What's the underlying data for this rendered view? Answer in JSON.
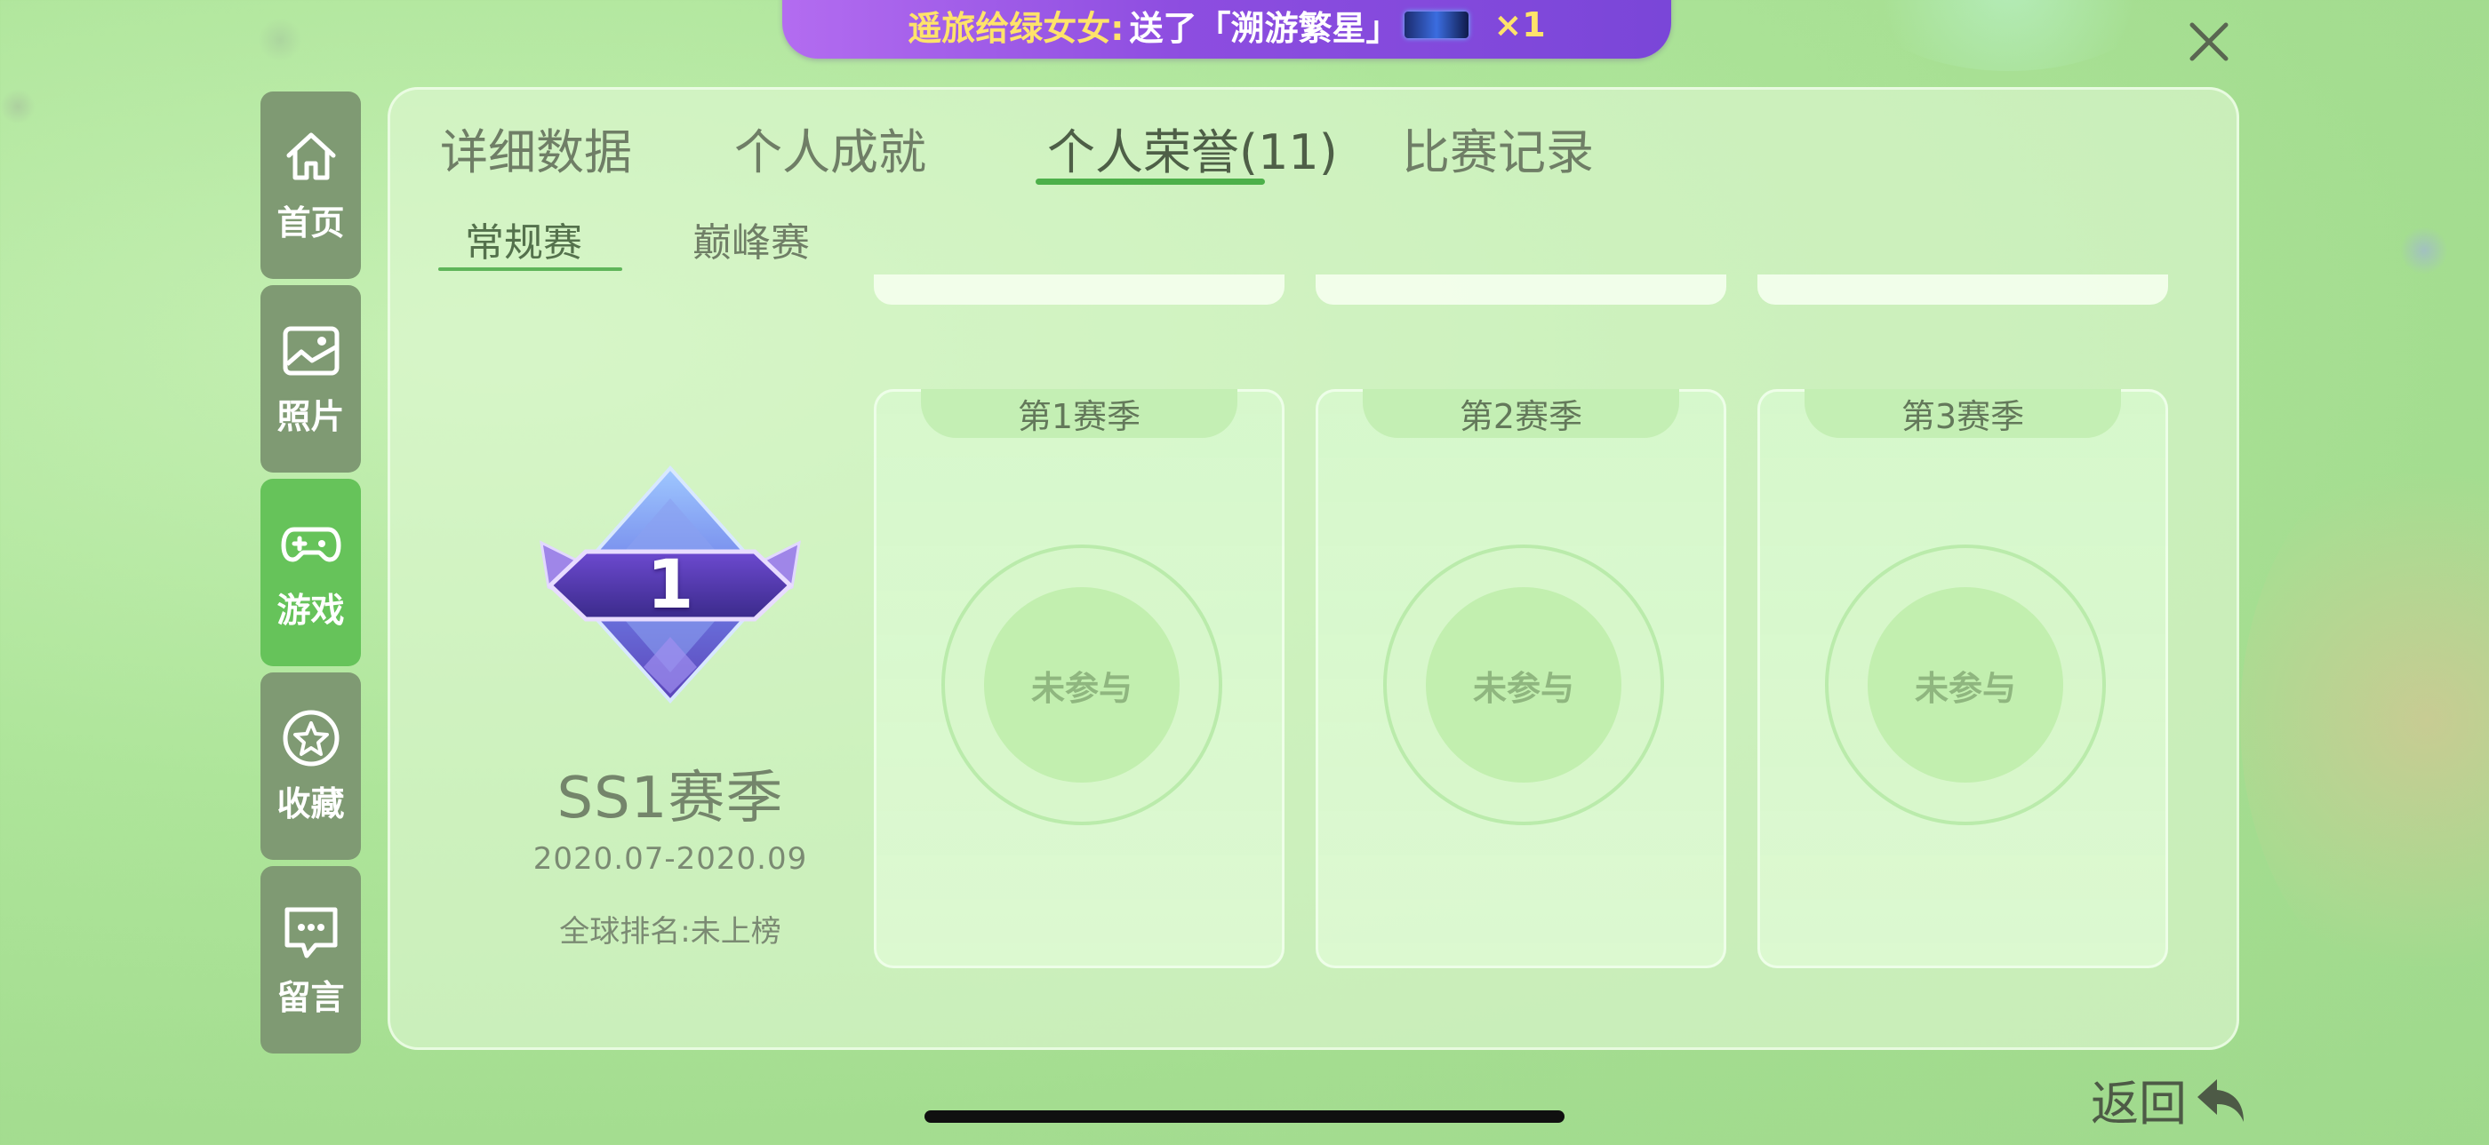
{
  "banner": {
    "sender": "遥旅给绿女女:",
    "message": "送了「溯游繁星」",
    "count": "×1"
  },
  "sidebar": {
    "items": [
      {
        "label": "首页",
        "icon": "home-icon"
      },
      {
        "label": "照片",
        "icon": "photo-icon"
      },
      {
        "label": "游戏",
        "icon": "gamepad-icon",
        "active": true
      },
      {
        "label": "收藏",
        "icon": "star-icon"
      },
      {
        "label": "留言",
        "icon": "message-icon"
      }
    ]
  },
  "tabs": {
    "items": [
      {
        "label": "详细数据"
      },
      {
        "label": "个人成就"
      },
      {
        "label": "个人荣誉(11)",
        "active": true
      },
      {
        "label": "比赛记录"
      }
    ]
  },
  "subtabs": {
    "items": [
      {
        "label": "常规赛",
        "active": true
      },
      {
        "label": "巅峰赛"
      }
    ]
  },
  "season": {
    "badge_number": "1",
    "name": "SS1赛季",
    "range": "2020.07-2020.09",
    "rank": "全球排名:未上榜"
  },
  "cards": [
    {
      "title": "第1赛季",
      "status": "未参与"
    },
    {
      "title": "第2赛季",
      "status": "未参与"
    },
    {
      "title": "第3赛季",
      "status": "未参与"
    }
  ],
  "back": {
    "label": "返回"
  },
  "colors": {
    "active_green": "#66c35a",
    "sidebar_gray_green": "#7f9a73",
    "banner_purple": "#8d4de0",
    "underline_green": "#4db04a"
  }
}
